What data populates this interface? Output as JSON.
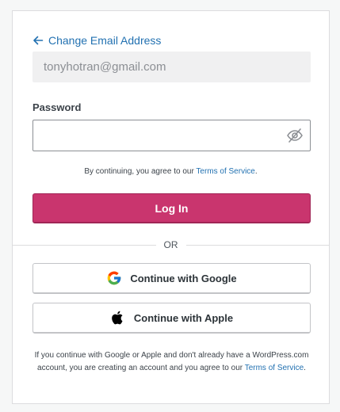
{
  "back_link": {
    "label": "Change Email Address",
    "icon": "arrow-left-icon"
  },
  "email": {
    "value": "tonyhotran@gmail.com"
  },
  "password": {
    "label": "Password",
    "value": "",
    "placeholder": "",
    "toggle_icon": "eye-slash-icon"
  },
  "terms_notice": {
    "prefix": "By continuing, you agree to our ",
    "link": "Terms of Service",
    "suffix": "."
  },
  "login_button": {
    "label": "Log In"
  },
  "divider": {
    "label": "OR"
  },
  "social": {
    "google": {
      "label": "Continue with Google",
      "icon": "google-icon"
    },
    "apple": {
      "label": "Continue with Apple",
      "icon": "apple-icon"
    }
  },
  "disclaimer": {
    "text": "If you continue with Google or Apple and don't already have a WordPress.com account, you are creating an account and you agree to our ",
    "link": "Terms of Service",
    "suffix": "."
  },
  "colors": {
    "primary": "#c9356e",
    "link": "#2271b1",
    "border": "#dcdcde"
  }
}
